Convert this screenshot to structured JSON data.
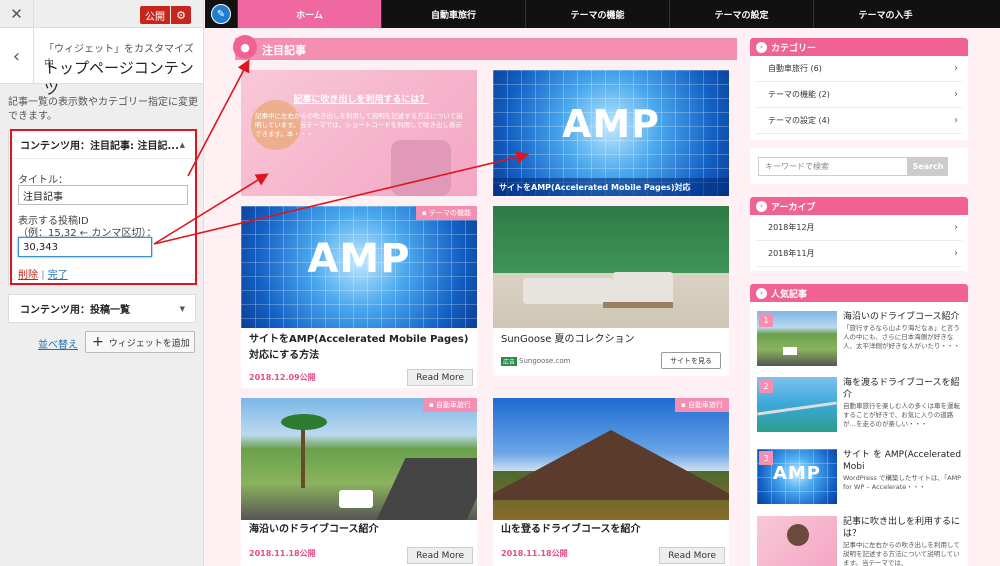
{
  "customizer": {
    "close_icon": "✕",
    "publish_label": "公開",
    "gear_icon": "⚙",
    "back_icon": "‹",
    "breadcrumb": "「ウィジェット」をカスタマイズ中",
    "panel_title": "トップページコンテンツ",
    "description": "記事一覧の表示数やカテゴリー指定に変更できます。",
    "widget1": {
      "header": "コンテンツ用：注目記事: 注目記...",
      "title_label": "タイトル：",
      "title_value": "注目記事",
      "ids_label": "表示する投稿ID",
      "ids_hint": "（例：15,32 ← カンマ区切）：",
      "ids_value": "30,343",
      "delete_label": "削除",
      "separator": "|",
      "done_label": "完了"
    },
    "widget2": {
      "header": "コンテンツ用：投稿一覧"
    },
    "reorder_label": "並べ替え",
    "add_widget_label": "ウィジェットを追加"
  },
  "preview": {
    "nav": [
      "ホーム",
      "自動車旅行",
      "テーマの機能",
      "テーマの設定",
      "テーマの入手"
    ],
    "section_title": "注目記事",
    "cards": [
      {
        "image_title": "記事に吹き出しを利用するには？",
        "image_text": "記事中に左右からの吹き出しを利用して説明を記述する方法について説明しています。当テーマでは、ショートコードを利用して吹き出し表示できます。本・・・"
      },
      {
        "image_label": "AMP",
        "overlay_caption": "サイトをAMP(Accelerated Mobile Pages)対応"
      },
      {
        "badge": "テーマの機能",
        "image_label": "AMP",
        "title": "サイトをAMP(Accelerated Mobile Pages)対応にする方法",
        "date": "2018.12.09公開",
        "read_more": "Read More"
      },
      {
        "title": "SunGoose 夏のコレクション",
        "ad_tag": "広告",
        "domain": "Sungoose.com",
        "cta": "サイトを見る"
      },
      {
        "badge": "自動車旅行",
        "title": "海沿いのドライブコース紹介",
        "date": "2018.11.18公開",
        "read_more": "Read More"
      },
      {
        "badge": "自動車旅行",
        "title": "山を登るドライブコースを紹介",
        "date": "2018.11.18公開",
        "read_more": "Read More"
      }
    ]
  },
  "sidebar": {
    "categories": {
      "title": "カテゴリー",
      "items": [
        "自動車旅行 (6)",
        "テーマの機能 (2)",
        "テーマの設定 (4)"
      ]
    },
    "search": {
      "placeholder": "キーワードで検索",
      "button": "Search"
    },
    "archive": {
      "title": "アーカイブ",
      "items": [
        "2018年12月",
        "2018年11月"
      ]
    },
    "popular": {
      "title": "人気記事",
      "items": [
        {
          "rank": "1",
          "title": "海沿いのドライブコース紹介",
          "desc": "「旅行するなら山より海だなぁ」と言う人の中にも、さらに日本海側が好きな人、太平洋側が好きな人がいたり・・・"
        },
        {
          "rank": "2",
          "title": "海を渡るドライブコースを紹介",
          "desc": "自動車旅行を楽しむ人の多くは車を運転することが好きで、お気に入りの道路が…を走るのが楽しい・・・"
        },
        {
          "rank": "3",
          "thumb_label": "AMP",
          "title": "サイト を AMP(Accelerated Mobi",
          "desc": "WordPress で構築したサイトは、「AMP for WP – Accelerate・・・"
        },
        {
          "title": "記事に吹き出しを利用するには？",
          "desc": "記事中に左右からの吹き出しを利用して説明を記述する方法について説明しています。当テーマでは、"
        }
      ]
    }
  },
  "colors": {
    "accent_pink": "#f06292",
    "highlight_red": "#e0141e",
    "nav_active": "#f068a0"
  }
}
